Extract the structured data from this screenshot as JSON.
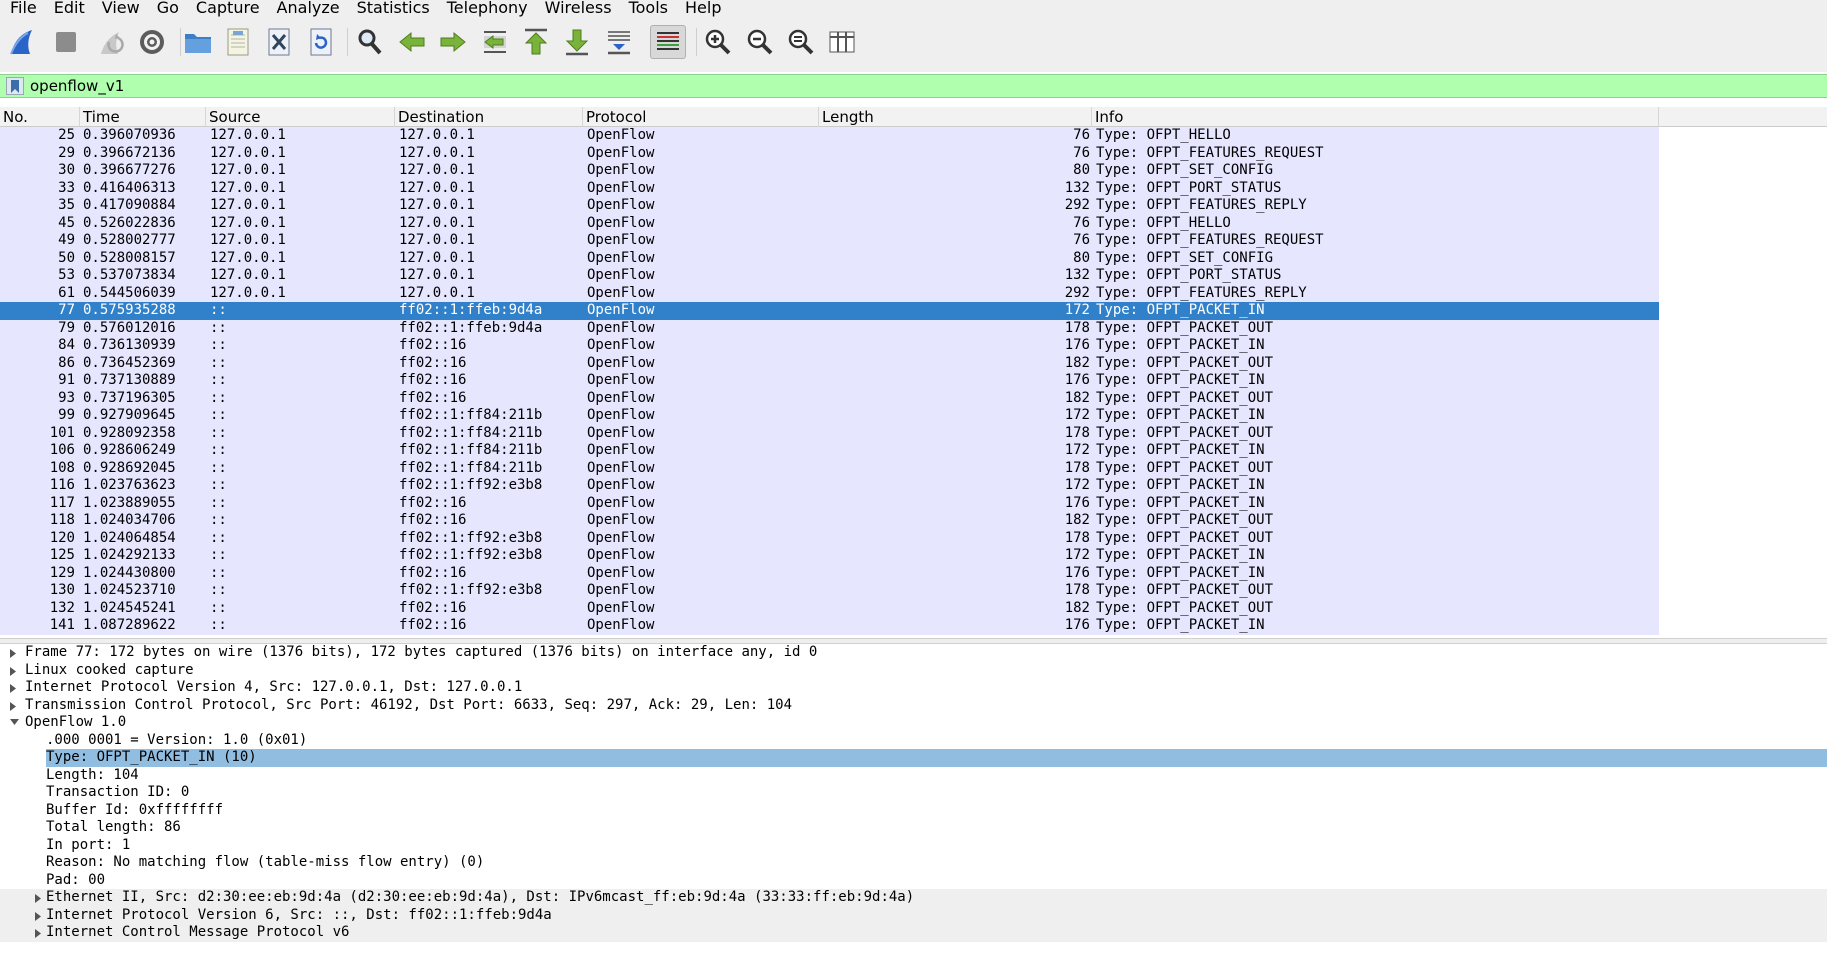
{
  "menu": [
    "File",
    "Edit",
    "View",
    "Go",
    "Capture",
    "Analyze",
    "Statistics",
    "Telephony",
    "Wireless",
    "Tools",
    "Help"
  ],
  "toolbar": {
    "icons": [
      "shark-fin-start-icon",
      "stop-icon",
      "restart-icon",
      "capture-options-icon",
      "open-folder-icon",
      "save-file-icon",
      "close-file-icon",
      "reload-icon",
      "find-packet-icon",
      "go-back-icon",
      "go-forward-icon",
      "go-to-packet-icon",
      "go-first-icon",
      "go-last-icon",
      "autoscroll-icon",
      "colorize-icon",
      "zoom-in-icon",
      "zoom-out-icon",
      "zoom-normal-icon",
      "resize-columns-icon"
    ]
  },
  "filter": {
    "value": "openflow_v1"
  },
  "columns": [
    "No.",
    "Time",
    "Source",
    "Destination",
    "Protocol",
    "Length",
    "Info"
  ],
  "packets": [
    {
      "no": "25",
      "time": "0.396070936",
      "src": "127.0.0.1",
      "dst": "127.0.0.1",
      "proto": "OpenFlow",
      "len": "76",
      "info": "Type: OFPT_HELLO"
    },
    {
      "no": "29",
      "time": "0.396672136",
      "src": "127.0.0.1",
      "dst": "127.0.0.1",
      "proto": "OpenFlow",
      "len": "76",
      "info": "Type: OFPT_FEATURES_REQUEST"
    },
    {
      "no": "30",
      "time": "0.396677276",
      "src": "127.0.0.1",
      "dst": "127.0.0.1",
      "proto": "OpenFlow",
      "len": "80",
      "info": "Type: OFPT_SET_CONFIG"
    },
    {
      "no": "33",
      "time": "0.416406313",
      "src": "127.0.0.1",
      "dst": "127.0.0.1",
      "proto": "OpenFlow",
      "len": "132",
      "info": "Type: OFPT_PORT_STATUS"
    },
    {
      "no": "35",
      "time": "0.417090884",
      "src": "127.0.0.1",
      "dst": "127.0.0.1",
      "proto": "OpenFlow",
      "len": "292",
      "info": "Type: OFPT_FEATURES_REPLY"
    },
    {
      "no": "45",
      "time": "0.526022836",
      "src": "127.0.0.1",
      "dst": "127.0.0.1",
      "proto": "OpenFlow",
      "len": "76",
      "info": "Type: OFPT_HELLO"
    },
    {
      "no": "49",
      "time": "0.528002777",
      "src": "127.0.0.1",
      "dst": "127.0.0.1",
      "proto": "OpenFlow",
      "len": "76",
      "info": "Type: OFPT_FEATURES_REQUEST"
    },
    {
      "no": "50",
      "time": "0.528008157",
      "src": "127.0.0.1",
      "dst": "127.0.0.1",
      "proto": "OpenFlow",
      "len": "80",
      "info": "Type: OFPT_SET_CONFIG"
    },
    {
      "no": "53",
      "time": "0.537073834",
      "src": "127.0.0.1",
      "dst": "127.0.0.1",
      "proto": "OpenFlow",
      "len": "132",
      "info": "Type: OFPT_PORT_STATUS"
    },
    {
      "no": "61",
      "time": "0.544506039",
      "src": "127.0.0.1",
      "dst": "127.0.0.1",
      "proto": "OpenFlow",
      "len": "292",
      "info": "Type: OFPT_FEATURES_REPLY"
    },
    {
      "no": "77",
      "time": "0.575935288",
      "src": "::",
      "dst": "ff02::1:ffeb:9d4a",
      "proto": "OpenFlow",
      "len": "172",
      "info": "Type: OFPT_PACKET_IN",
      "selected": true
    },
    {
      "no": "79",
      "time": "0.576012016",
      "src": "::",
      "dst": "ff02::1:ffeb:9d4a",
      "proto": "OpenFlow",
      "len": "178",
      "info": "Type: OFPT_PACKET_OUT"
    },
    {
      "no": "84",
      "time": "0.736130939",
      "src": "::",
      "dst": "ff02::16",
      "proto": "OpenFlow",
      "len": "176",
      "info": "Type: OFPT_PACKET_IN"
    },
    {
      "no": "86",
      "time": "0.736452369",
      "src": "::",
      "dst": "ff02::16",
      "proto": "OpenFlow",
      "len": "182",
      "info": "Type: OFPT_PACKET_OUT"
    },
    {
      "no": "91",
      "time": "0.737130889",
      "src": "::",
      "dst": "ff02::16",
      "proto": "OpenFlow",
      "len": "176",
      "info": "Type: OFPT_PACKET_IN"
    },
    {
      "no": "93",
      "time": "0.737196305",
      "src": "::",
      "dst": "ff02::16",
      "proto": "OpenFlow",
      "len": "182",
      "info": "Type: OFPT_PACKET_OUT"
    },
    {
      "no": "99",
      "time": "0.927909645",
      "src": "::",
      "dst": "ff02::1:ff84:211b",
      "proto": "OpenFlow",
      "len": "172",
      "info": "Type: OFPT_PACKET_IN"
    },
    {
      "no": "101",
      "time": "0.928092358",
      "src": "::",
      "dst": "ff02::1:ff84:211b",
      "proto": "OpenFlow",
      "len": "178",
      "info": "Type: OFPT_PACKET_OUT"
    },
    {
      "no": "106",
      "time": "0.928606249",
      "src": "::",
      "dst": "ff02::1:ff84:211b",
      "proto": "OpenFlow",
      "len": "172",
      "info": "Type: OFPT_PACKET_IN"
    },
    {
      "no": "108",
      "time": "0.928692045",
      "src": "::",
      "dst": "ff02::1:ff84:211b",
      "proto": "OpenFlow",
      "len": "178",
      "info": "Type: OFPT_PACKET_OUT"
    },
    {
      "no": "116",
      "time": "1.023763623",
      "src": "::",
      "dst": "ff02::1:ff92:e3b8",
      "proto": "OpenFlow",
      "len": "172",
      "info": "Type: OFPT_PACKET_IN"
    },
    {
      "no": "117",
      "time": "1.023889055",
      "src": "::",
      "dst": "ff02::16",
      "proto": "OpenFlow",
      "len": "176",
      "info": "Type: OFPT_PACKET_IN"
    },
    {
      "no": "118",
      "time": "1.024034706",
      "src": "::",
      "dst": "ff02::16",
      "proto": "OpenFlow",
      "len": "182",
      "info": "Type: OFPT_PACKET_OUT"
    },
    {
      "no": "120",
      "time": "1.024064854",
      "src": "::",
      "dst": "ff02::1:ff92:e3b8",
      "proto": "OpenFlow",
      "len": "178",
      "info": "Type: OFPT_PACKET_OUT"
    },
    {
      "no": "125",
      "time": "1.024292133",
      "src": "::",
      "dst": "ff02::1:ff92:e3b8",
      "proto": "OpenFlow",
      "len": "172",
      "info": "Type: OFPT_PACKET_IN"
    },
    {
      "no": "129",
      "time": "1.024430800",
      "src": "::",
      "dst": "ff02::16",
      "proto": "OpenFlow",
      "len": "176",
      "info": "Type: OFPT_PACKET_IN"
    },
    {
      "no": "130",
      "time": "1.024523710",
      "src": "::",
      "dst": "ff02::1:ff92:e3b8",
      "proto": "OpenFlow",
      "len": "178",
      "info": "Type: OFPT_PACKET_OUT"
    },
    {
      "no": "132",
      "time": "1.024545241",
      "src": "::",
      "dst": "ff02::16",
      "proto": "OpenFlow",
      "len": "182",
      "info": "Type: OFPT_PACKET_OUT"
    },
    {
      "no": "141",
      "time": "1.087289622",
      "src": "::",
      "dst": "ff02::16",
      "proto": "OpenFlow",
      "len": "176",
      "info": "Type: OFPT_PACKET_IN"
    }
  ],
  "details": [
    {
      "level": 0,
      "expand": "collapsed",
      "text": "Frame 77: 172 bytes on wire (1376 bits), 172 bytes captured (1376 bits) on interface any, id 0"
    },
    {
      "level": 0,
      "expand": "collapsed",
      "text": "Linux cooked capture"
    },
    {
      "level": 0,
      "expand": "collapsed",
      "text": "Internet Protocol Version 4, Src: 127.0.0.1, Dst: 127.0.0.1"
    },
    {
      "level": 0,
      "expand": "collapsed",
      "text": "Transmission Control Protocol, Src Port: 46192, Dst Port: 6633, Seq: 297, Ack: 29, Len: 104"
    },
    {
      "level": 0,
      "expand": "expanded",
      "text": "OpenFlow 1.0"
    },
    {
      "level": 1,
      "expand": "none",
      "text": ".000 0001 = Version: 1.0 (0x01)"
    },
    {
      "level": 1,
      "expand": "none",
      "text": "Type: OFPT_PACKET_IN (10)",
      "selected": true
    },
    {
      "level": 1,
      "expand": "none",
      "text": "Length: 104"
    },
    {
      "level": 1,
      "expand": "none",
      "text": "Transaction ID: 0"
    },
    {
      "level": 1,
      "expand": "none",
      "text": "Buffer Id: 0xffffffff"
    },
    {
      "level": 1,
      "expand": "none",
      "text": "Total length: 86"
    },
    {
      "level": 1,
      "expand": "none",
      "text": "In port: 1"
    },
    {
      "level": 1,
      "expand": "none",
      "text": "Reason: No matching flow (table-miss flow entry) (0)"
    },
    {
      "level": 1,
      "expand": "none",
      "text": "Pad: 00"
    },
    {
      "level": 1,
      "expand": "collapsed",
      "text": "Ethernet II, Src: d2:30:ee:eb:9d:4a (d2:30:ee:eb:9d:4a), Dst: IPv6mcast_ff:eb:9d:4a (33:33:ff:eb:9d:4a)"
    },
    {
      "level": 1,
      "expand": "collapsed",
      "text": "Internet Protocol Version 6, Src: ::, Dst: ff02::1:ffeb:9d4a"
    },
    {
      "level": 1,
      "expand": "collapsed",
      "text": "Internet Control Message Protocol v6"
    }
  ],
  "colors": {
    "filter_valid_bg": "#afffaf",
    "row_bg": "#e7e6ff",
    "row_selected_bg": "#3081c9",
    "detail_selected_bg": "#91bde0"
  }
}
